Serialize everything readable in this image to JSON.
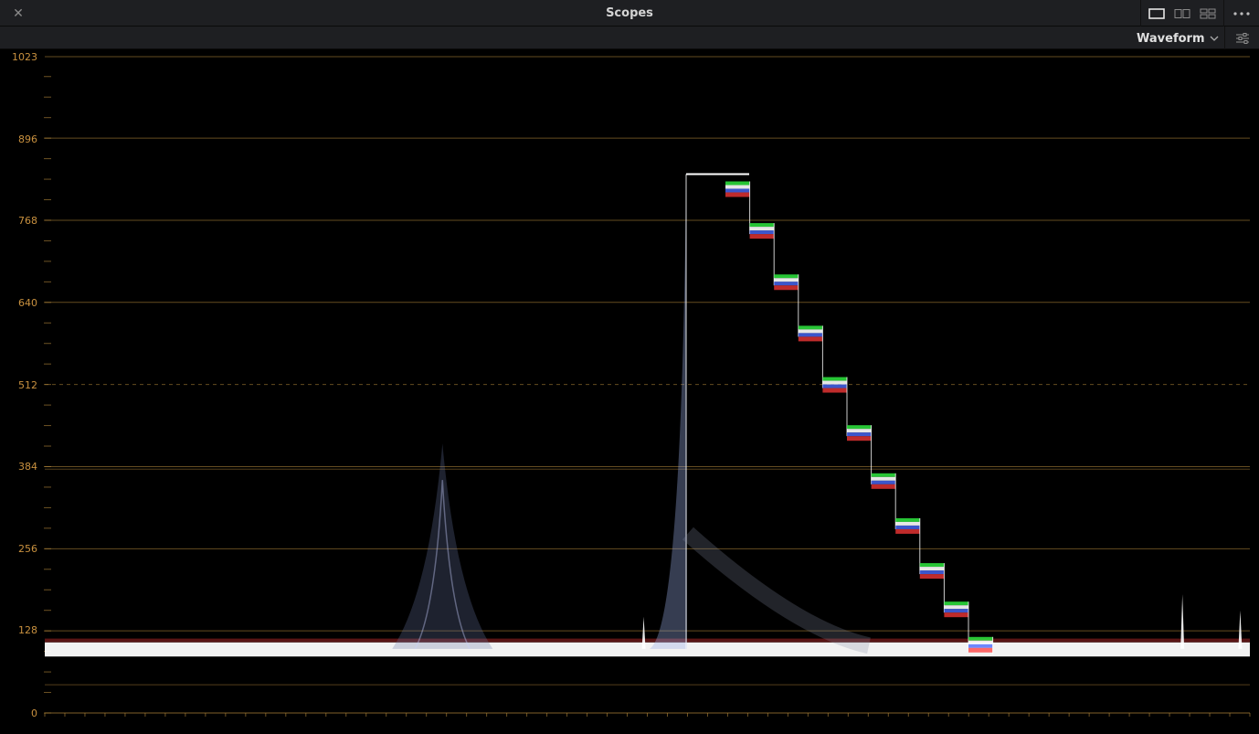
{
  "window": {
    "title": "Scopes"
  },
  "toolbar": {
    "mode": "Waveform"
  },
  "icons": {
    "close": "close-icon",
    "layout_single": "single-layout-icon",
    "layout_dual": "dual-layout-icon",
    "layout_quad": "quad-layout-icon",
    "more": "more-options-icon",
    "chevron": "chevron-down-icon",
    "settings": "sliders-icon"
  },
  "colors": {
    "graticule": "#b88a3c",
    "axis_text": "#c9913f",
    "trace_white": "#ffffff",
    "trace_red": "#ff3a3a",
    "trace_green": "#2ee83e",
    "trace_blue": "#4b6bff"
  },
  "scale": {
    "labels": [
      "1023",
      "896",
      "768",
      "640",
      "512",
      "384",
      "256",
      "128",
      "0"
    ]
  },
  "waveform": {
    "ymax": 1023,
    "baseline": 100,
    "top_plateau": 840,
    "steps": [
      820,
      755,
      675,
      595,
      515,
      440,
      365,
      295,
      225,
      165,
      110,
      100
    ],
    "bumps": [
      {
        "x": 0.33,
        "level": 420
      }
    ],
    "spikes": [
      {
        "x": 0.497,
        "level": 150
      },
      {
        "x": 0.944,
        "level": 185
      },
      {
        "x": 0.992,
        "level": 160
      }
    ]
  }
}
